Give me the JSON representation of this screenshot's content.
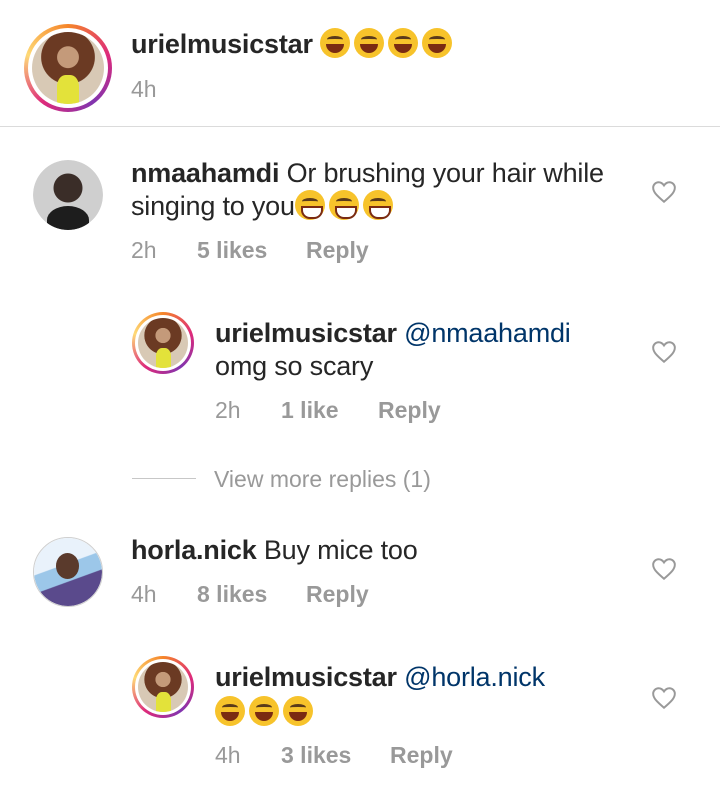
{
  "caption": {
    "username": "urielmusicstar",
    "emoji_count": 4,
    "time": "4h"
  },
  "comments": [
    {
      "username": "nmaahamdi",
      "text_line1": "Or brushing your hair while",
      "text_line2": "singing to you",
      "emoji_count": 3,
      "time": "2h",
      "likes": "5 likes",
      "reply_label": "Reply",
      "icon": "heart-outline-icon"
    },
    {
      "username": "urielmusicstar",
      "mention": "@nmaahamdi",
      "text": "omg so scary",
      "time": "2h",
      "likes": "1 like",
      "reply_label": "Reply",
      "icon": "heart-outline-icon"
    },
    {
      "username": "horla.nick",
      "text": "Buy mice too",
      "time": "4h",
      "likes": "8 likes",
      "reply_label": "Reply",
      "icon": "heart-outline-icon"
    },
    {
      "username": "urielmusicstar",
      "mention": "@horla.nick",
      "emoji_count": 3,
      "time": "4h",
      "likes": "3 likes",
      "reply_label": "Reply",
      "icon": "heart-outline-icon"
    }
  ],
  "view_more": "View more replies (1)",
  "colors": {
    "text": "#262626",
    "meta": "#999999",
    "mention": "#003569",
    "divider": "#dbdbdb"
  }
}
